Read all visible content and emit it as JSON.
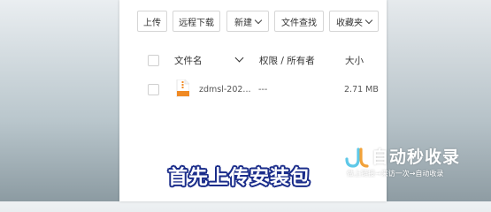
{
  "toolbar": {
    "upload": "上传",
    "remote_download": "远程下载",
    "new": "新建",
    "file_search": "文件查找",
    "favorites": "收藏夹"
  },
  "table_header": {
    "file_name": "文件名",
    "permissions_owner": "权限 / 所有者",
    "size": "大小"
  },
  "files": [
    {
      "name": "zdmsl-202...",
      "permissions": "---",
      "size": "2.71 MB"
    }
  ],
  "caption": "首先上传安装包",
  "watermark": {
    "title": "自动秒收录",
    "subtitle": "做上链接→来访一次→自动收录"
  },
  "colors": {
    "caption_outline": "#1a2c8a",
    "file_icon": "#f08a24"
  }
}
